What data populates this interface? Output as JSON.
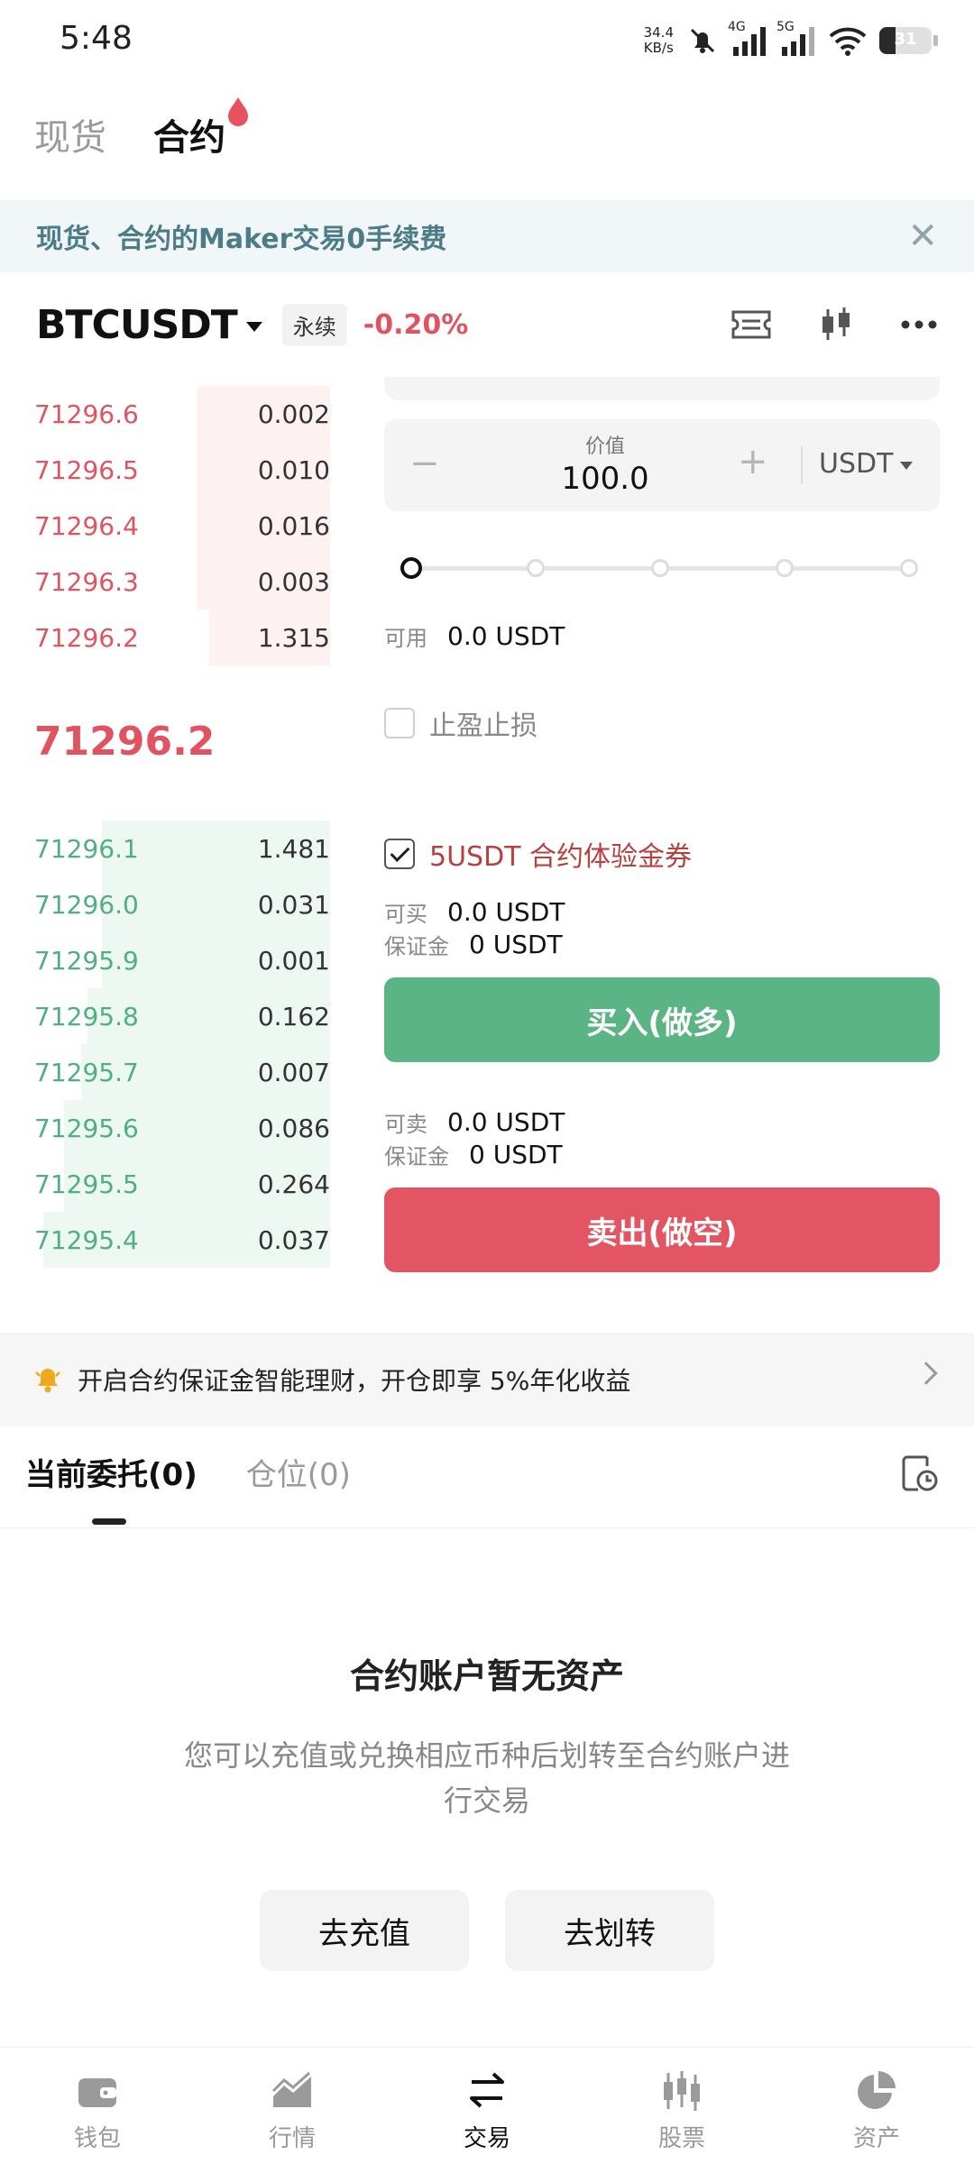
{
  "status_bar": {
    "time": "5:48",
    "speed_value": "34.4",
    "speed_unit": "KB/s",
    "net1": "4G",
    "net2": "5G",
    "battery": "31"
  },
  "top_tabs": [
    {
      "label": "现货",
      "active": false
    },
    {
      "label": "合约",
      "active": true
    }
  ],
  "banner": {
    "text": "现货、合约的Maker交易0手续费",
    "close_icon": "close-icon"
  },
  "symbol_row": {
    "symbol": "BTCUSDT",
    "type_badge": "永续",
    "change": "-0.20%",
    "icons": [
      "ticket-icon",
      "candlestick-icon",
      "more-icon"
    ]
  },
  "order_book": {
    "asks": [
      {
        "price": "71296.6",
        "qty": "0.002",
        "depth": 0.45
      },
      {
        "price": "71296.5",
        "qty": "0.010",
        "depth": 0.45
      },
      {
        "price": "71296.4",
        "qty": "0.016",
        "depth": 0.45
      },
      {
        "price": "71296.3",
        "qty": "0.003",
        "depth": 0.45
      },
      {
        "price": "71296.2",
        "qty": "1.315",
        "depth": 0.41
      }
    ],
    "last_price": "71296.2",
    "bids": [
      {
        "price": "71296.1",
        "qty": "1.481",
        "depth": 0.77
      },
      {
        "price": "71296.0",
        "qty": "0.031",
        "depth": 0.77
      },
      {
        "price": "71295.9",
        "qty": "0.001",
        "depth": 0.77
      },
      {
        "price": "71295.8",
        "qty": "0.162",
        "depth": 0.82
      },
      {
        "price": "71295.7",
        "qty": "0.007",
        "depth": 0.84
      },
      {
        "price": "71295.6",
        "qty": "0.086",
        "depth": 0.9
      },
      {
        "price": "71295.5",
        "qty": "0.264",
        "depth": 0.9
      },
      {
        "price": "71295.4",
        "qty": "0.037",
        "depth": 0.97
      }
    ]
  },
  "order_form": {
    "value_label": "价值",
    "value": "100.0",
    "minus": "−",
    "plus": "+",
    "unit": "USDT",
    "slider_level": 0,
    "available_label": "可用",
    "available_value": "0.0 USDT",
    "tp_sl_label": "止盈止损",
    "coupon_label": "5USDT 合约体验金券",
    "buy_qty_label": "可买",
    "buy_qty_value": "0.0 USDT",
    "buy_margin_label": "保证金",
    "buy_margin_value": "0 USDT",
    "buy_button": "买入(做多)",
    "sell_qty_label": "可卖",
    "sell_qty_value": "0.0 USDT",
    "sell_margin_label": "保证金",
    "sell_margin_value": "0 USDT",
    "sell_button": "卖出(做空)"
  },
  "promo": {
    "text": "开启合约保证金智能理财，开仓即享 5%年化收益",
    "icon": "bell-icon"
  },
  "order_tabs": [
    {
      "label": "当前委托(0)",
      "active": true
    },
    {
      "label": "仓位(0)",
      "active": false
    }
  ],
  "empty_state": {
    "title": "合约账户暂无资产",
    "description": "您可以充值或兑换相应币种后划转至合约账户进行交易",
    "deposit_button": "去充值",
    "transfer_button": "去划转"
  },
  "bottom_nav": [
    {
      "label": "钱包",
      "icon": "wallet-icon",
      "active": false
    },
    {
      "label": "行情",
      "icon": "market-chart-icon",
      "active": false
    },
    {
      "label": "交易",
      "icon": "trade-arrows-icon",
      "active": true
    },
    {
      "label": "股票",
      "icon": "stocks-icon",
      "active": false
    },
    {
      "label": "资产",
      "icon": "pie-chart-icon",
      "active": false
    }
  ],
  "colors": {
    "sell": "#e05361",
    "buy": "#4fae82",
    "buy_button": "#5bb483",
    "sell_button": "#e35563"
  }
}
